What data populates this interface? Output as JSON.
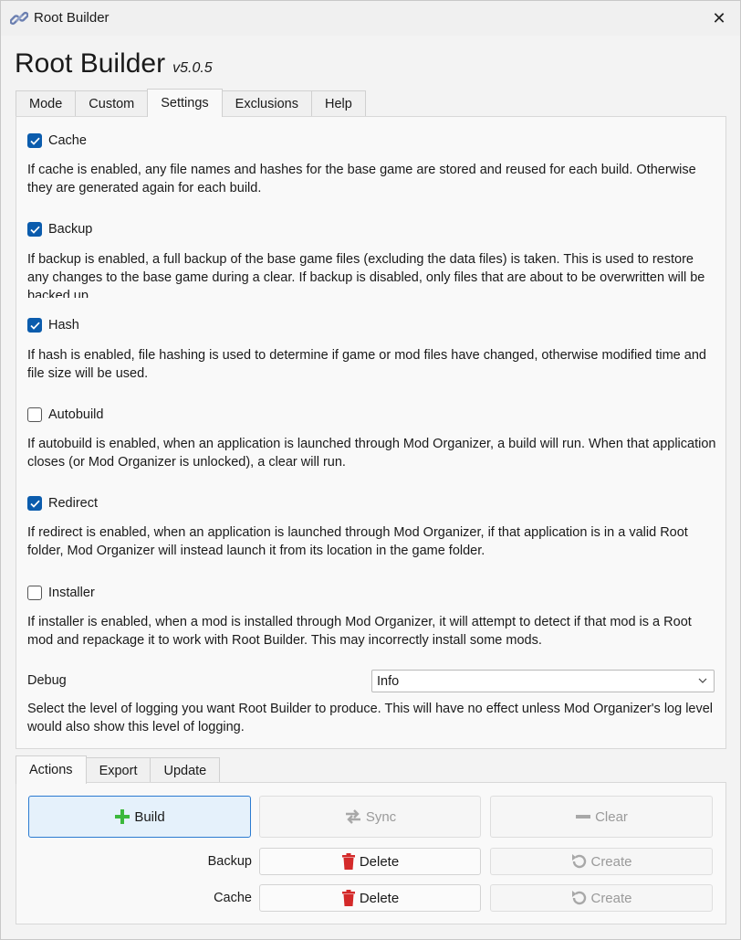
{
  "window": {
    "title": "Root Builder",
    "close_glyph": "✕"
  },
  "header": {
    "app_name": "Root Builder",
    "version": "v5.0.5"
  },
  "tabs": [
    {
      "label": "Mode",
      "active": false
    },
    {
      "label": "Custom",
      "active": false
    },
    {
      "label": "Settings",
      "active": true
    },
    {
      "label": "Exclusions",
      "active": false
    },
    {
      "label": "Help",
      "active": false
    }
  ],
  "settings": {
    "options": [
      {
        "label": "Cache",
        "checked": true,
        "description": "If cache is enabled, any file names and hashes for the base game are stored and reused for each build. Otherwise they are generated again for each build."
      },
      {
        "label": "Backup",
        "checked": true,
        "description": "If backup is enabled, a full backup of the base game files (excluding the data files) is taken. This is used to restore any changes to the base game during a clear. If backup is disabled, only files that are about to be overwritten will be backed up."
      },
      {
        "label": "Hash",
        "checked": true,
        "description": "If hash is enabled, file hashing is used to determine if game or mod files have changed, otherwise modified time and file size will be used."
      },
      {
        "label": "Autobuild",
        "checked": false,
        "description": "If autobuild is enabled, when an application is launched through Mod Organizer, a build will run. When that application closes (or Mod Organizer is unlocked), a clear will run."
      },
      {
        "label": "Redirect",
        "checked": true,
        "description": "If redirect is enabled, when an application is launched through Mod Organizer, if that application is in a valid Root folder, Mod Organizer will instead launch it from its location in the game folder."
      },
      {
        "label": "Installer",
        "checked": false,
        "description": "If installer is enabled, when a mod is installed through Mod Organizer, it will attempt to detect if that mod is a Root mod and repackage it to work with Root Builder. This may incorrectly install some mods."
      }
    ],
    "debug": {
      "label": "Debug",
      "selected": "Info",
      "description": "Select the level of logging you want Root Builder to produce. This will have no effect unless Mod Organizer's log level would also show this level of logging."
    }
  },
  "action_tabs": [
    {
      "label": "Actions",
      "active": true
    },
    {
      "label": "Export",
      "active": false
    },
    {
      "label": "Update",
      "active": false
    }
  ],
  "actions": {
    "build": "Build",
    "sync": "Sync",
    "clear": "Clear",
    "backup_label": "Backup",
    "cache_label": "Cache",
    "delete": "Delete",
    "create": "Create"
  },
  "colors": {
    "accent": "#0b5cad",
    "primary_button_bg": "#e5f1fb",
    "build_icon": "#3cb83c",
    "delete_icon": "#d42a2a"
  }
}
